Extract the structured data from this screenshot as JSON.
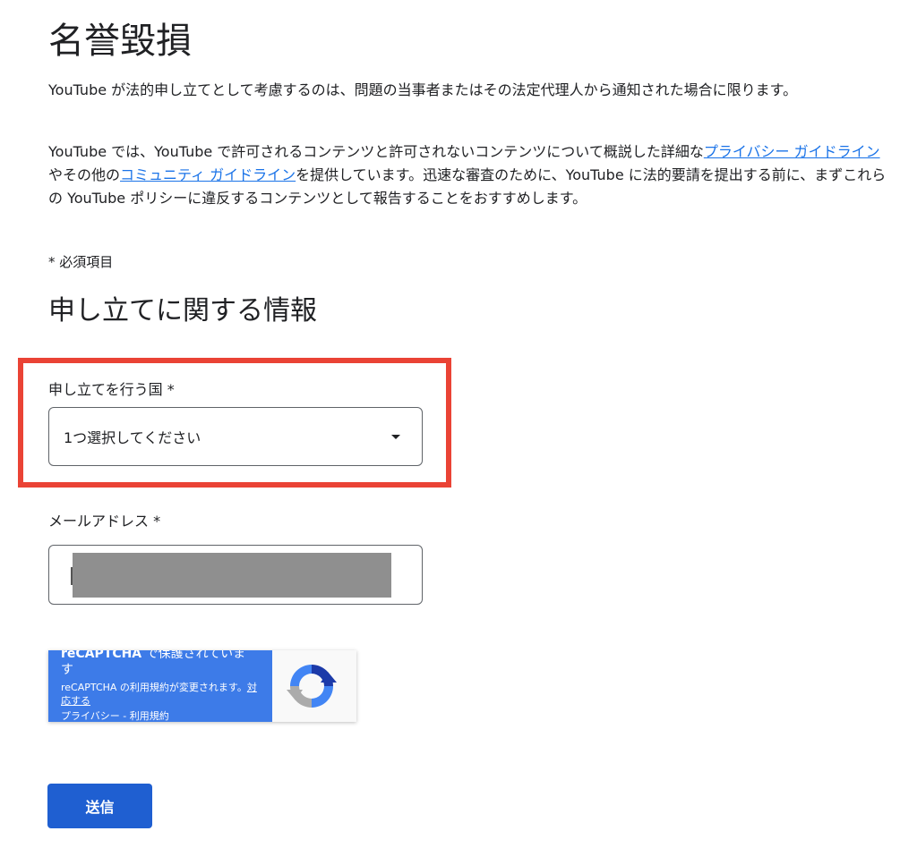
{
  "page": {
    "title": "名誉毀損",
    "intro": "YouTube が法的申し立てとして考慮するのは、問題の当事者またはその法定代理人から通知された場合に限ります。",
    "policy": {
      "part1": "YouTube では、YouTube で許可されるコンテンツと許可されないコンテンツについて概説した詳細な",
      "link1": "プライバシー ガイドライン",
      "part2": "やその他の",
      "link2": "コミュニティ ガイドライン",
      "part3": "を提供しています。迅速な審査のために、YouTube に法的要請を提出する前に、まずこれらの YouTube ポリシーに違反するコンテンツとして報告することをおすすめします。"
    },
    "required_note": "* 必須項目",
    "section_title": "申し立てに関する情報"
  },
  "form": {
    "country": {
      "label": "申し立てを行う国 *",
      "value": "1つ選択してください"
    },
    "email": {
      "label": "メールアドレス *"
    },
    "submit_label": "送信"
  },
  "recaptcha": {
    "heading": "reCAPTCHA",
    "heading_suffix": " で保護されていま",
    "heading_line2": "す",
    "notice": "reCAPTCHA の利用規約が変更されます。",
    "notice_link": "対応する",
    "links": "プライバシー - 利用規約"
  },
  "colors": {
    "highlight": "#ea4335",
    "link": "#1a73e8",
    "button": "#1f5fd1",
    "recaptcha_panel": "#3d7be8"
  }
}
